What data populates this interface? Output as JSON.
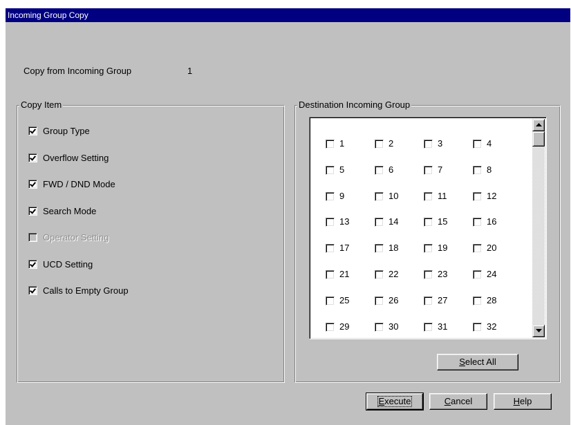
{
  "window": {
    "title": "Incoming Group Copy"
  },
  "copy_from": {
    "label": "Copy from Incoming Group",
    "value": "1"
  },
  "copy_item": {
    "legend": "Copy Item",
    "items": [
      {
        "label": "Group Type",
        "checked": true,
        "enabled": true
      },
      {
        "label": "Overflow Setting",
        "checked": true,
        "enabled": true
      },
      {
        "label": "FWD / DND Mode",
        "checked": true,
        "enabled": true
      },
      {
        "label": "Search Mode",
        "checked": true,
        "enabled": true
      },
      {
        "label": "Operator Setting",
        "checked": false,
        "enabled": false
      },
      {
        "label": "UCD Setting",
        "checked": true,
        "enabled": true
      },
      {
        "label": "Calls to Empty Group",
        "checked": true,
        "enabled": true
      }
    ]
  },
  "destination": {
    "legend": "Destination Incoming Group",
    "groups": [
      "1",
      "2",
      "3",
      "4",
      "5",
      "6",
      "7",
      "8",
      "9",
      "10",
      "11",
      "12",
      "13",
      "14",
      "15",
      "16",
      "17",
      "18",
      "19",
      "20",
      "21",
      "22",
      "23",
      "24",
      "25",
      "26",
      "27",
      "28",
      "29",
      "30",
      "31",
      "32"
    ],
    "scroll_up_icon": "arrow-up",
    "scroll_down_icon": "arrow-down",
    "select_all": {
      "mnemonic": "S",
      "rest": "elect All"
    }
  },
  "buttons": {
    "execute": {
      "mnemonic": "E",
      "rest": "xecute"
    },
    "cancel": {
      "mnemonic": "C",
      "rest": "ancel"
    },
    "help": {
      "mnemonic": "H",
      "rest": "elp"
    }
  },
  "colors": {
    "title_bar": "#000080",
    "face": "#c0c0c0",
    "disabled_text": "#909090"
  }
}
